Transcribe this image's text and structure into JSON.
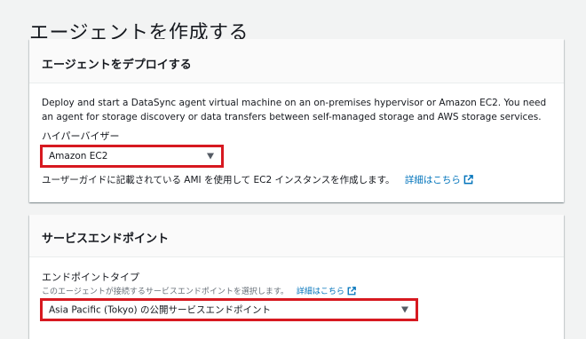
{
  "page": {
    "title": "エージェントを作成する"
  },
  "deploy_panel": {
    "title": "エージェントをデプロイする",
    "description": "Deploy and start a DataSync agent virtual machine on an on-premises hypervisor or Amazon EC2. You need an agent for storage discovery or data transfers between self-managed storage and AWS storage services.",
    "hypervisor_label": "ハイパーバイザー",
    "hypervisor_value": "Amazon EC2",
    "note_text": "ユーザーガイドに記載されている AMI を使用して EC2 インスタンスを作成します。",
    "learn_more": "詳細はこちら"
  },
  "endpoint_panel": {
    "title": "サービスエンドポイント",
    "type_label": "エンドポイントタイプ",
    "type_description": "このエージェントが接続するサービスエンドポイントを選択します。",
    "learn_more": "詳細はこちら",
    "type_value": "Asia Pacific (Tokyo) の公開サービスエンドポイント"
  },
  "colors": {
    "background": "#f2f3f3",
    "panel": "#ffffff",
    "highlight_border": "#d71920",
    "link": "#0073bb"
  }
}
